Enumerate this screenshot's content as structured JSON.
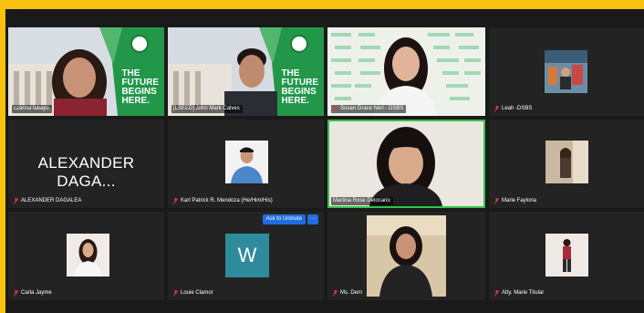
{
  "participants": [
    {
      "name": "czarina labayo",
      "muted": false
    },
    {
      "name": "[LSEED] John Mark Calves",
      "muted": false
    },
    {
      "name": "Susan Grace Neri - DSBS",
      "muted": true
    },
    {
      "name": "Leah -DSBS",
      "muted": true
    },
    {
      "name": "ALEXANDER DAGALEA",
      "display": "ALEXANDER DAGA...",
      "muted": true
    },
    {
      "name": "Karl Patrick R. Mendoza (He/Him/His)",
      "muted": true
    },
    {
      "name": "Martina Rose Delocario",
      "muted": false
    },
    {
      "name": "Marie Faylona",
      "muted": true
    },
    {
      "name": "Carla Jayme",
      "muted": true
    },
    {
      "name": "Louie Clamor",
      "avatar_letter": "W",
      "muted": true
    },
    {
      "name": "Ms. Dem",
      "muted": true
    },
    {
      "name": "Atty. Marie Titular",
      "muted": true
    }
  ],
  "banner": {
    "line1": "THE",
    "line2": "FUTURE",
    "line3": "BEGINS",
    "line4": "HERE."
  },
  "controls": {
    "ask_to_unmute": "Ask to Unmute",
    "more": "···"
  },
  "colors": {
    "frame_border": "#f6c10f",
    "active_speaker": "#35c24a",
    "button": "#1f6de0",
    "avatar_bg": "#2e8b9b"
  }
}
